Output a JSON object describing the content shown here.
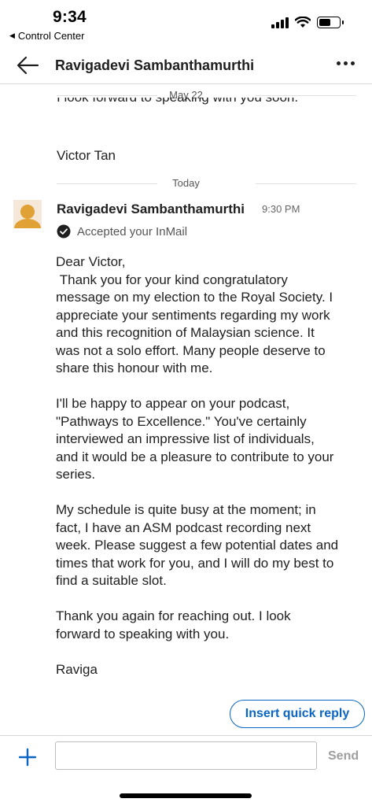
{
  "status_bar": {
    "time": "9:34",
    "back_app_label": "Control Center"
  },
  "header": {
    "title": "Ravigadevi Sambanthamurthi"
  },
  "thread": {
    "previous_date": "May 22",
    "previous_clipped_line": "I look forward to speaking with you soon.",
    "previous_signature": "Victor Tan",
    "today_label": "Today"
  },
  "message": {
    "sender": "Ravigadevi Sambanthamurthi",
    "time": "9:30 PM",
    "status": "Accepted your InMail",
    "paragraphs": [
      "Dear Victor,\n Thank you for your kind congratulatory message on my election to the Royal Society. I appreciate your sentiments regarding my work and this recognition of Malaysian science. It was not a solo effort. Many people deserve to share this honour with me.",
      "I'll be happy to appear on your podcast, \"Pathways to Excellence.\" You've certainly interviewed an impressive list of individuals, and it would be a pleasure to contribute to your series.",
      "My schedule is quite busy at the moment; in fact, I have an ASM podcast recording next week. Please suggest a few potential dates and times that work for you, and I will do my best to find a suitable slot.",
      "Thank you again for reaching out. I look forward to speaking with you.",
      "Raviga"
    ]
  },
  "quick_reply": {
    "label": "Insert quick reply"
  },
  "composer": {
    "input_value": "",
    "send_label": "Send"
  },
  "colors": {
    "accent": "#0a66c2",
    "avatar": "#e0a137",
    "muted": "#9e9e9e"
  }
}
